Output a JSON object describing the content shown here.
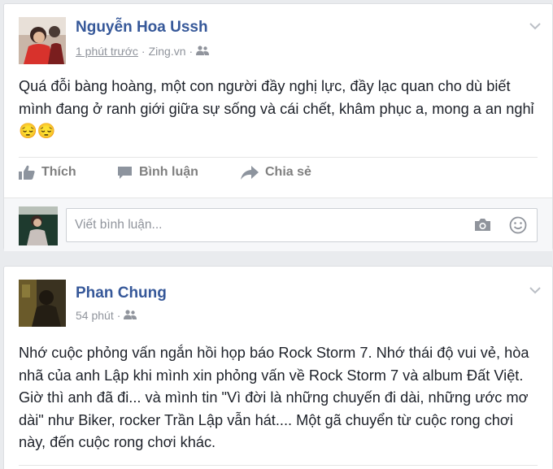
{
  "posts": [
    {
      "author": "Nguyễn Hoa Ussh",
      "time": "1 phút trước",
      "separator": "·",
      "source": "Zing.vn",
      "privacy_icon": "friends-icon",
      "content": "Quá đỗi bàng hoàng, một con người đầy nghị lực, đầy lạc quan cho dù biết mình đang ở ranh giới giữa sự sống và cái chết, khâm phục a, mong a an nghỉ 😔😔",
      "actions": {
        "like": "Thích",
        "comment": "Bình luận",
        "share": "Chia sẻ"
      },
      "comment_placeholder": "Viết bình luận..."
    },
    {
      "author": "Phan Chung",
      "time": "54 phút",
      "separator": "·",
      "privacy_icon": "friends-icon",
      "content": "Nhớ cuộc phỏng vấn ngắn hồi họp báo Rock Storm 7. Nhớ thái độ vui vẻ, hòa nhã của anh Lập khi mình xin phỏng vấn về Rock Storm 7 và album Đất Việt. Giờ thì anh đã đi... và mình tin \"Vì đời là những chuyến đi dài, những ước mơ dài\" như Biker, rocker Trần Lập vẫn hát.... Một gã chuyển từ cuộc rong chơi này, đến cuộc rong chơi khác."
    }
  ],
  "colors": {
    "name": "#365899",
    "meta": "#90949c",
    "text": "#1d2129",
    "background": "#e9ebee"
  }
}
